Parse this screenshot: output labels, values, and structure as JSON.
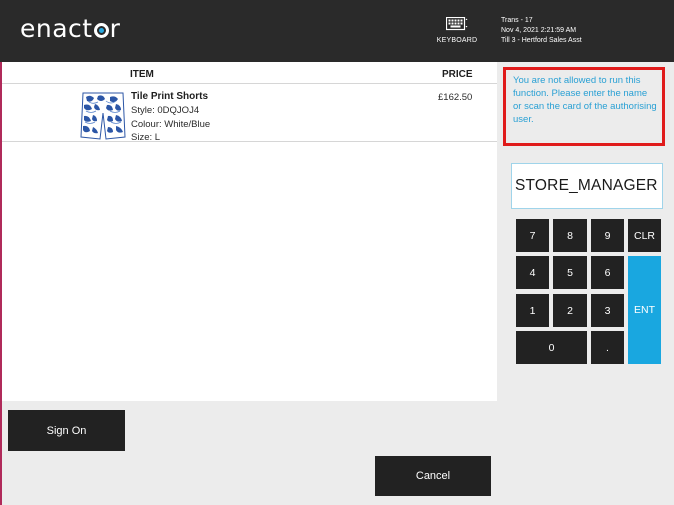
{
  "header": {
    "logo_text_pre": "enact",
    "logo_text_post": "r",
    "keyboard_label": "KEYBOARD",
    "keyboard_icon": "keyboard-icon",
    "trans": "Trans - 17",
    "datetime": "Nov 4, 2021 2:21:59 AM",
    "till": "Till 3 - Hertford Sales Asst"
  },
  "basket": {
    "columns": {
      "item": "ITEM",
      "price": "PRICE"
    },
    "items": [
      {
        "name": "Tile Print Shorts",
        "style": "Style: 0DQJOJ4",
        "colour": "Colour: White/Blue",
        "size": "Size: L",
        "price": "£162.50"
      }
    ]
  },
  "message": {
    "text": "You are not allowed to run this function. Please enter the name or scan the card of the authorising user."
  },
  "auth_input": {
    "value": "STORE_MANAGER"
  },
  "keypad": {
    "keys": [
      "7",
      "8",
      "9",
      "CLR",
      "4",
      "5",
      "6",
      "1",
      "2",
      "3",
      "ENT",
      "0",
      "."
    ]
  },
  "buttons": {
    "sign_on": "Sign On",
    "cancel": "Cancel"
  },
  "colors": {
    "header_bg": "#2a2a2a",
    "accent_blue": "#19a7e0",
    "error_border": "#e01b1b",
    "button_dark": "#222222"
  }
}
